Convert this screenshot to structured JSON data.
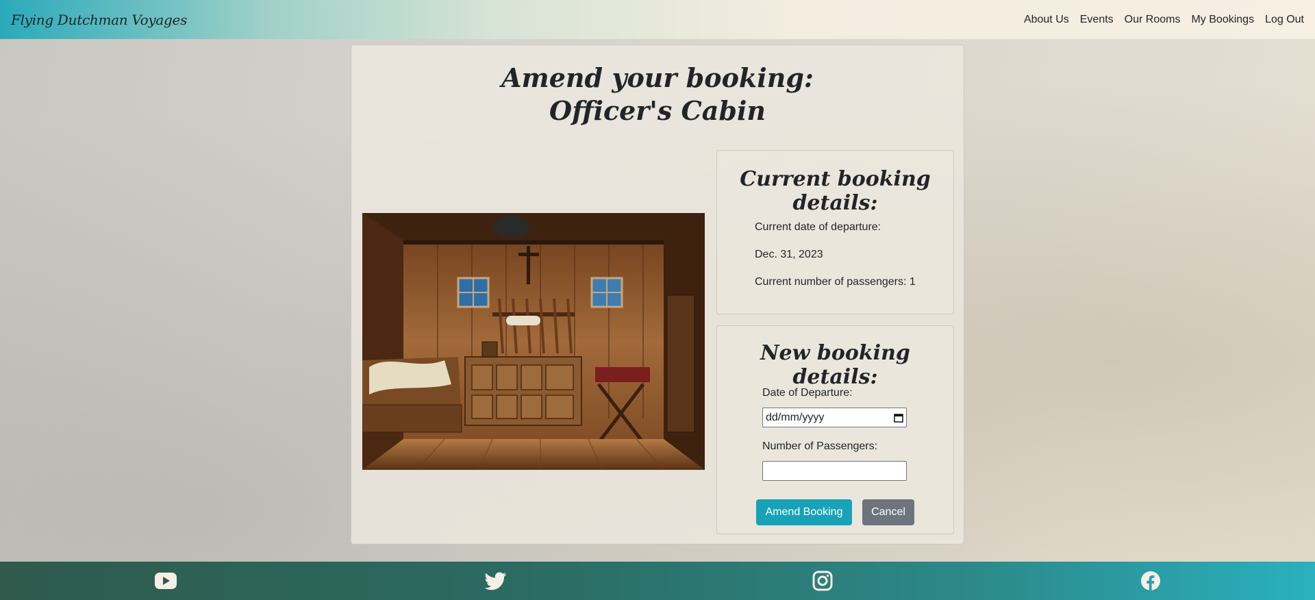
{
  "navbar": {
    "brand": "Flying Dutchman Voyages",
    "links": [
      "About Us",
      "Events",
      "Our Rooms",
      "My Bookings",
      "Log Out"
    ]
  },
  "page": {
    "title_line1": "Amend your booking:",
    "title_line2": "Officer's Cabin"
  },
  "current_booking": {
    "heading": "Current booking details:",
    "departure_label": "Current date of departure:",
    "departure_date": "Dec. 31, 2023",
    "passengers_text": "Current number of passengers: 1"
  },
  "new_booking": {
    "heading": "New booking details:",
    "date_label": "Date of Departure:",
    "date_placeholder": "dd/mm/yyyy",
    "passengers_label": "Number of Passengers:",
    "passengers_value": "",
    "amend_button": "Amend Booking",
    "cancel_button": "Cancel"
  },
  "footer": {
    "icons": [
      "youtube-icon",
      "twitter-icon",
      "instagram-icon",
      "facebook-icon"
    ]
  },
  "colors": {
    "primary": "#17a2b8",
    "secondary": "#6c757d",
    "footer_start": "#2f5a4c",
    "footer_end": "#2ab0bf",
    "icon": "#f5f0e6"
  }
}
